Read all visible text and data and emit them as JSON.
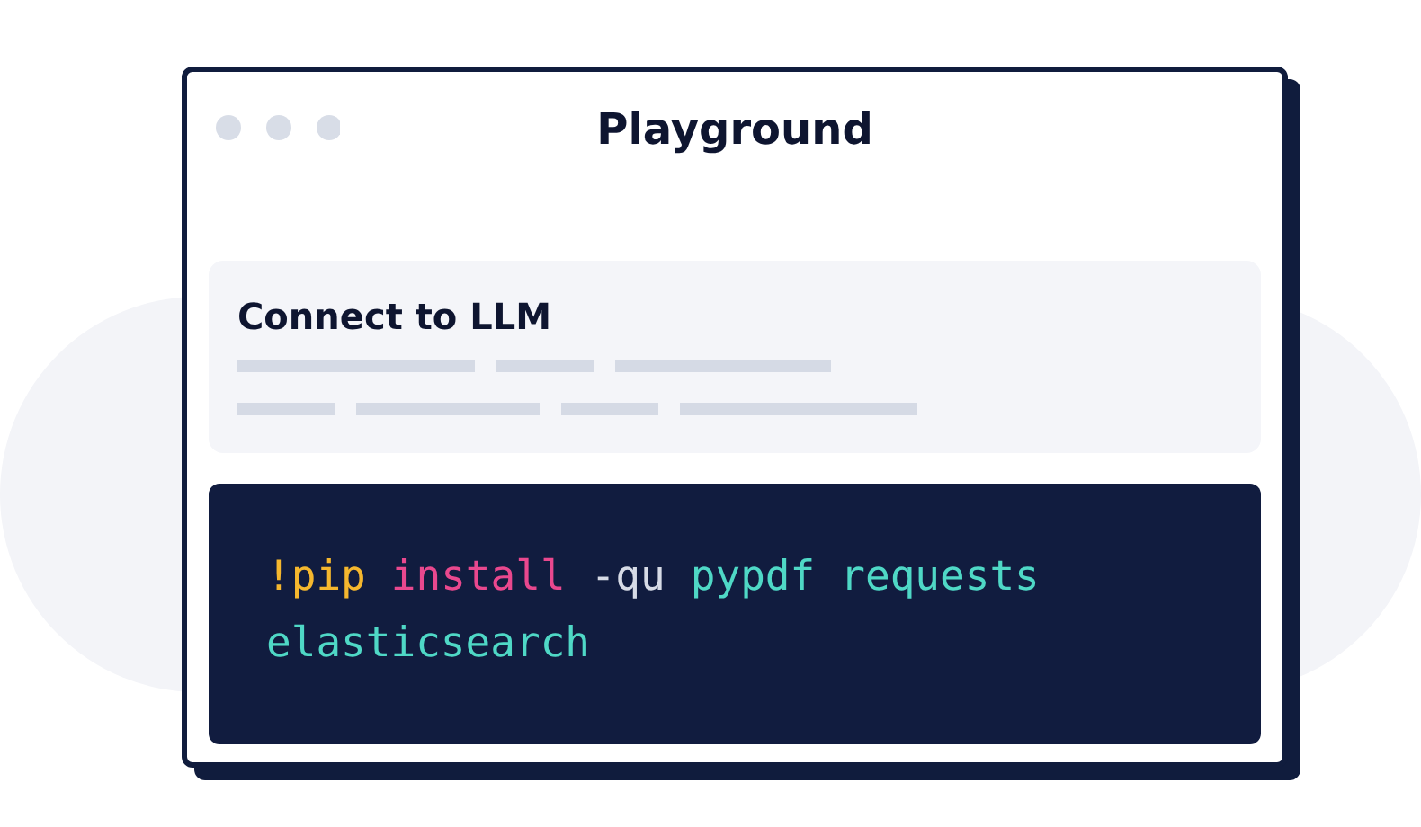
{
  "window": {
    "title": "Playground"
  },
  "card": {
    "title": "Connect to LLM"
  },
  "code": {
    "lines": [
      [
        {
          "text": "!pip",
          "color": "#f5b72e"
        },
        {
          "text": "install",
          "color": "#e9488e"
        },
        {
          "text": "-qu",
          "color": "#d7dbe6"
        },
        {
          "text": "pypdf",
          "color": "#4fd8c6"
        },
        {
          "text": "requests",
          "color": "#4fd8c6"
        }
      ],
      [
        {
          "text": "elasticsearch",
          "color": "#4fd8c6"
        }
      ]
    ]
  }
}
